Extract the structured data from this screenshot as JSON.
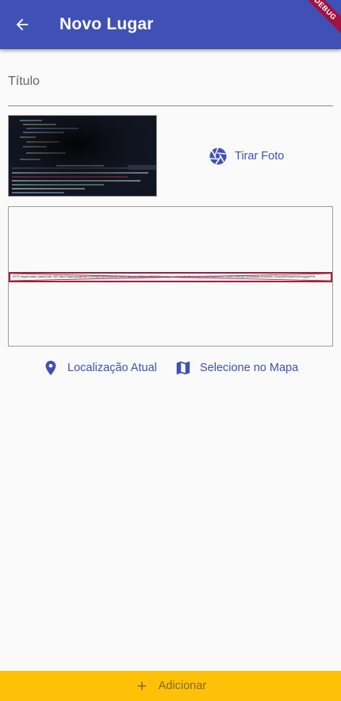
{
  "appbar": {
    "title": "Novo Lugar",
    "background": "#3f51b5",
    "banner": "DEBUG"
  },
  "form": {
    "title_placeholder": "Título",
    "title_value": ""
  },
  "image": {
    "take_photo_label": "Tirar Foto",
    "thumbnail": "code-screenshot-photo"
  },
  "map": {
    "error_text": "HTTP request failed, statusCode: 403, https://maps.googleapis.com/maps/api/staticmap?center=&zoom=13&size=600x300&maptype=roadmap&markers=color:red%7Clabel:A%7C&key=AIzaSyB-3H4h6d4aw-ZsxDeNlH-79ua4hWEN4t0nEWFtnuqyAtPFB"
  },
  "location": {
    "current_label": "Localização Atual",
    "select_map_label": "Selecione no Mapa"
  },
  "footer": {
    "add_label": "Adicionar",
    "background": "#ffc107"
  },
  "colors": {
    "primary": "#3f51b5",
    "accent": "#ffc107",
    "error_border": "#9b2348"
  }
}
